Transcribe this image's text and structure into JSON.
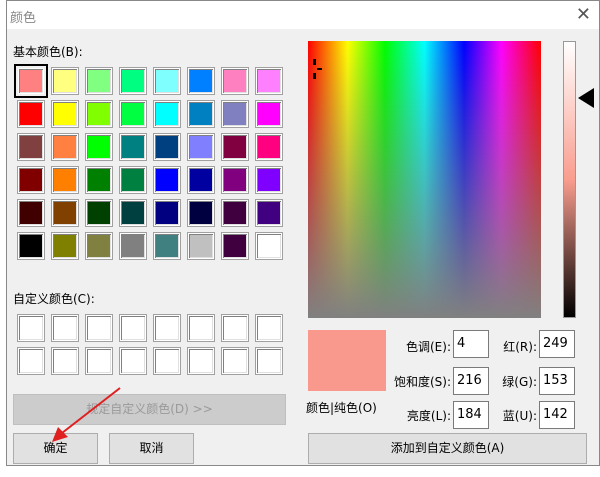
{
  "dialog": {
    "title": "颜色",
    "close_icon": "close-icon"
  },
  "basic": {
    "label": "基本颜色(B):",
    "selected": 0,
    "colors": [
      "#FF8080",
      "#FFFF80",
      "#80FF80",
      "#00FF80",
      "#80FFFF",
      "#0080FF",
      "#FF80C0",
      "#FF80FF",
      "#FF0000",
      "#FFFF00",
      "#80FF00",
      "#00FF40",
      "#00FFFF",
      "#0080C0",
      "#8080C0",
      "#FF00FF",
      "#804040",
      "#FF8040",
      "#00FF00",
      "#008080",
      "#004080",
      "#8080FF",
      "#800040",
      "#FF0080",
      "#800000",
      "#FF8000",
      "#008000",
      "#008040",
      "#0000FF",
      "#0000A0",
      "#800080",
      "#8000FF",
      "#400000",
      "#804000",
      "#004000",
      "#004040",
      "#000080",
      "#000040",
      "#400040",
      "#400080",
      "#000000",
      "#808000",
      "#808040",
      "#808080",
      "#408080",
      "#C0C0C0",
      "#400040",
      "#FFFFFF"
    ]
  },
  "custom": {
    "label": "自定义颜色(C):",
    "colors": [
      "#FFFFFF",
      "#FFFFFF",
      "#FFFFFF",
      "#FFFFFF",
      "#FFFFFF",
      "#FFFFFF",
      "#FFFFFF",
      "#FFFFFF",
      "#FFFFFF",
      "#FFFFFF",
      "#FFFFFF",
      "#FFFFFF",
      "#FFFFFF",
      "#FFFFFF",
      "#FFFFFF",
      "#FFFFFF"
    ]
  },
  "buttons": {
    "define_custom": "规定自定义颜色(D) >>",
    "ok": "确定",
    "cancel": "取消",
    "add_custom": "添加到自定义颜色(A)"
  },
  "preview": {
    "label": "颜色|纯色(O)",
    "color": "#F9998E"
  },
  "fields": {
    "hue": {
      "label": "色调(E):",
      "value": "4"
    },
    "sat": {
      "label": "饱和度(S):",
      "value": "216"
    },
    "lum": {
      "label": "亮度(L):",
      "value": "184"
    },
    "red": {
      "label": "红(R):",
      "value": "249"
    },
    "green": {
      "label": "绿(G):",
      "value": "153"
    },
    "blue": {
      "label": "蓝(U):",
      "value": "142"
    }
  },
  "annotation": {
    "arrow_color": "#E02020"
  }
}
